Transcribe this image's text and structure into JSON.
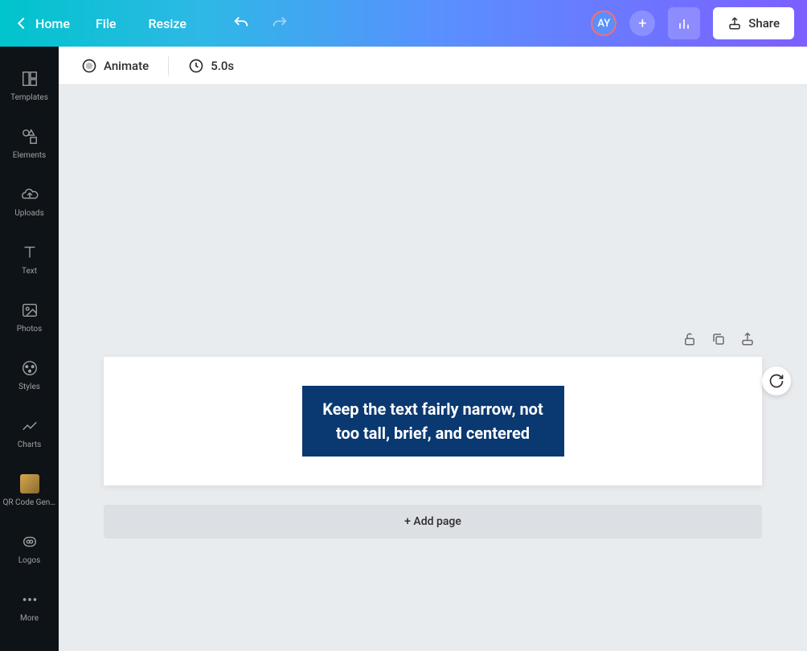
{
  "header": {
    "home": "Home",
    "file": "File",
    "resize": "Resize",
    "avatar_initials": "AY",
    "share": "Share"
  },
  "sidebar": {
    "items": [
      {
        "label": "Templates"
      },
      {
        "label": "Elements"
      },
      {
        "label": "Uploads"
      },
      {
        "label": "Text"
      },
      {
        "label": "Photos"
      },
      {
        "label": "Styles"
      },
      {
        "label": "Charts"
      },
      {
        "label": "QR Code Gen..."
      },
      {
        "label": "Logos"
      },
      {
        "label": "More"
      }
    ]
  },
  "toolbar": {
    "animate": "Animate",
    "duration": "5.0s"
  },
  "canvas": {
    "text_content": "Keep the text fairly narrow, not too tall, brief, and centered",
    "add_page": "+ Add page"
  }
}
